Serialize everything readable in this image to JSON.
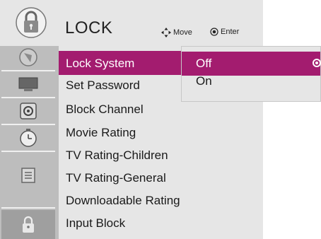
{
  "header": {
    "title": "LOCK",
    "move_label": "Move",
    "enter_label": "Enter"
  },
  "sidebar": {
    "items": [
      {
        "icon": "picture-icon"
      },
      {
        "icon": "monitor-icon"
      },
      {
        "icon": "audio-icon"
      },
      {
        "icon": "clock-icon"
      },
      {
        "icon": "option-icon"
      },
      {
        "icon": "lock-icon",
        "active": true
      }
    ]
  },
  "menu": {
    "items": [
      "Lock System",
      "Set Password",
      "Block Channel",
      "Movie Rating",
      "TV Rating-Children",
      "TV Rating-General",
      "Downloadable Rating",
      "Input Block"
    ],
    "selected_value": ": ("
  },
  "popup": {
    "options": [
      {
        "label": "Off",
        "selected": true
      },
      {
        "label": "On",
        "selected": false
      }
    ]
  },
  "colors": {
    "accent": "#a31c6f",
    "panel_bg": "#e6e6e6",
    "sidebar_bg": "#bdbdbd"
  }
}
